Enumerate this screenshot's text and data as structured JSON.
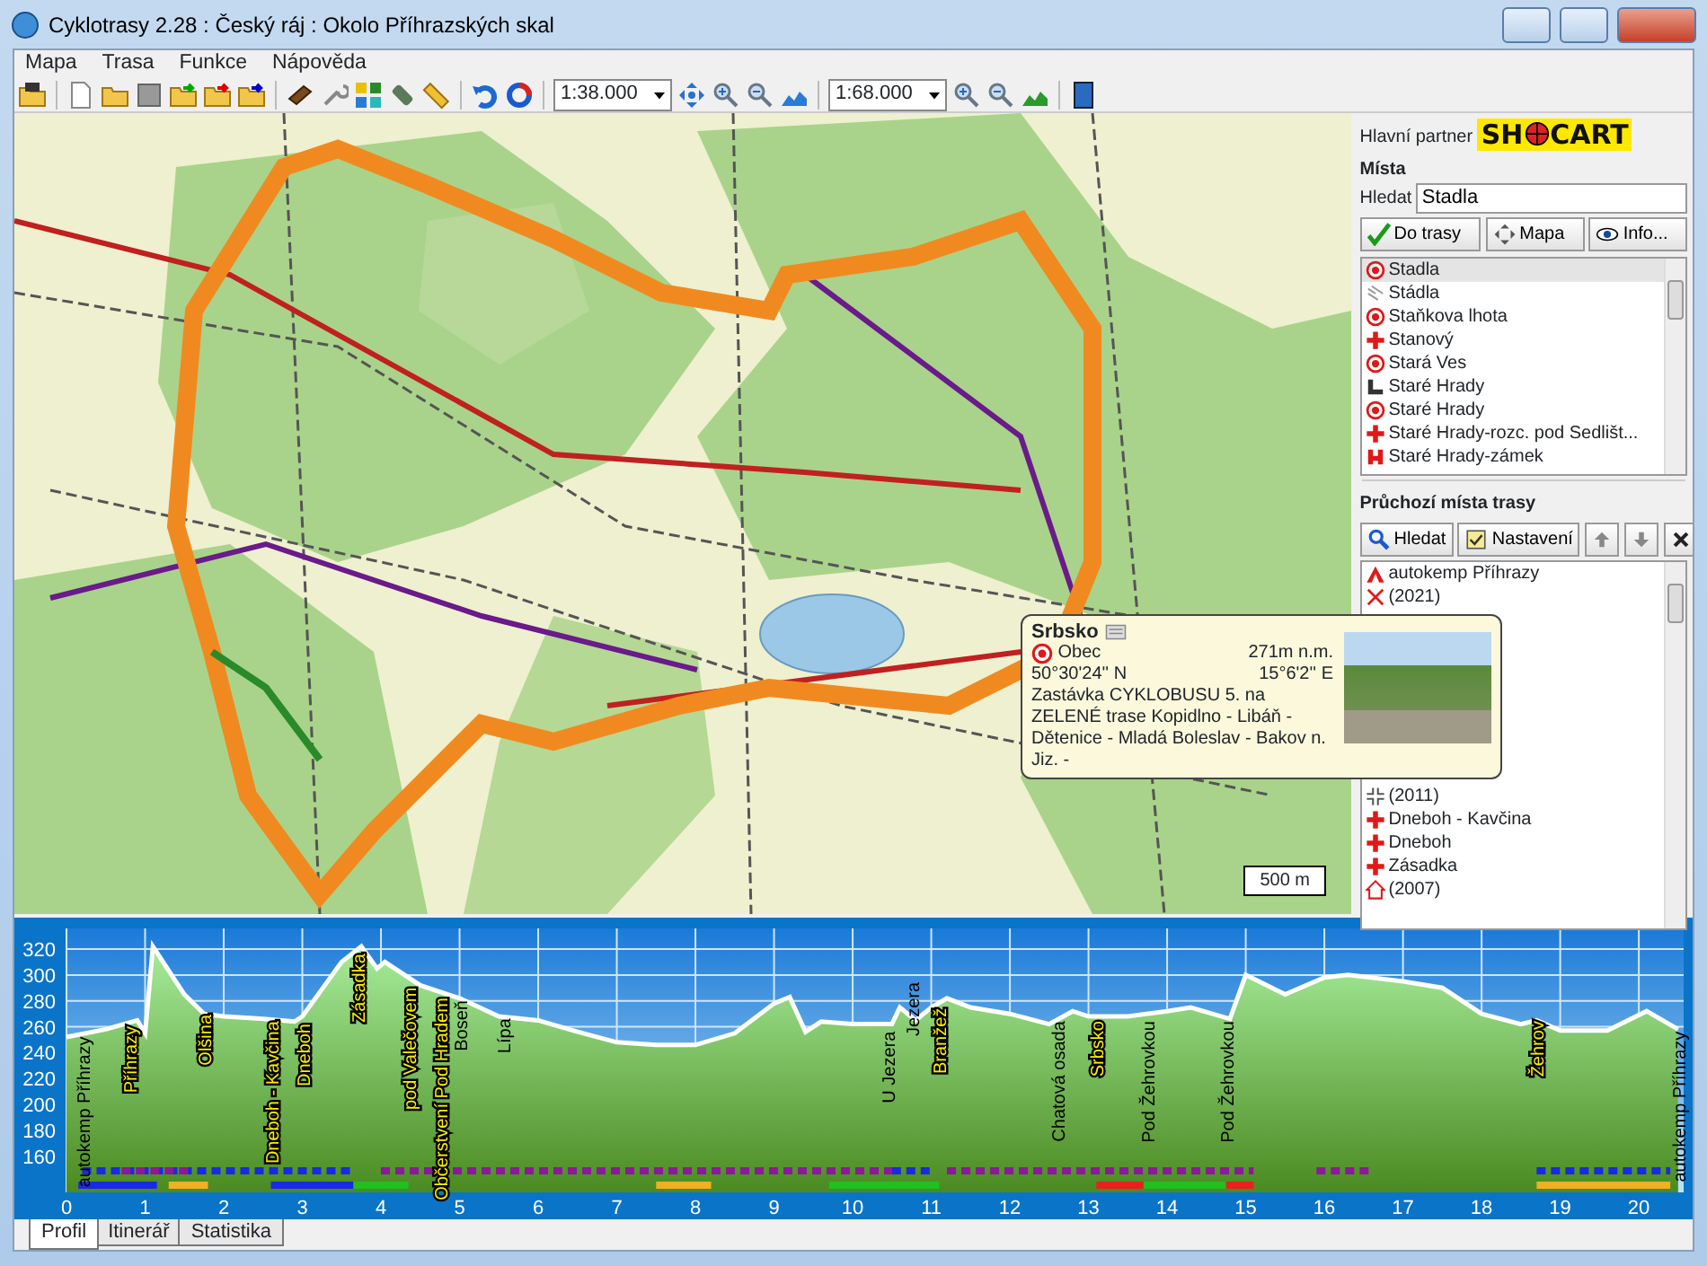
{
  "window": {
    "title": "Cyklotrasy 2.28 : Český ráj : Okolo Příhrazských skal"
  },
  "menu": [
    "Mapa",
    "Trasa",
    "Funkce",
    "Nápověda"
  ],
  "toolbar": {
    "scale_1": "1:38.000",
    "scale_2": "1:68.000"
  },
  "map": {
    "scale_label": "500 m"
  },
  "popup": {
    "title": "Srbsko",
    "type": "Obec",
    "altitude": "271m n.m.",
    "latitude": "50°30'24'' N",
    "longitude": "15°6'2'' E",
    "description": "Zastávka CYKLOBUSU 5. na ZELENÉ trase Kopidlno - Libáň - Dětenice - Mladá Boleslav - Bakov n. Jiz. -"
  },
  "sidebar": {
    "partner_label": "Hlavní partner",
    "logo_left": "SH",
    "logo_right": "CART",
    "places_title": "Místa",
    "search_label": "Hledat",
    "search_value": "Stadla",
    "buttons": [
      "Do trasy",
      "Mapa",
      "Info..."
    ],
    "places": [
      {
        "kind": "village",
        "name": "Stadla",
        "selected": true
      },
      {
        "kind": "settlement",
        "name": "Stádla",
        "selected": false
      },
      {
        "kind": "village",
        "name": "Staňkova lhota",
        "selected": false
      },
      {
        "kind": "cross",
        "name": "Stanový",
        "selected": false
      },
      {
        "kind": "village",
        "name": "Stará Ves",
        "selected": false
      },
      {
        "kind": "ruin",
        "name": "Staré Hrady",
        "selected": false
      },
      {
        "kind": "village",
        "name": "Staré Hrady",
        "selected": false
      },
      {
        "kind": "cross",
        "name": "Staré Hrady-rozc. pod Sedlišt...",
        "selected": false
      },
      {
        "kind": "castle",
        "name": "Staré Hrady-zámek",
        "selected": false
      }
    ],
    "route_title": "Průchozí místa trasy",
    "route_buttons": [
      "Hledat",
      "Nastavení"
    ],
    "route_places": [
      {
        "kind": "camp",
        "name": "autokemp Příhrazy"
      },
      {
        "kind": "service",
        "name": "(2021)"
      },
      {
        "kind": "junction",
        "name": "(2011)"
      },
      {
        "kind": "cross",
        "name": "Dneboh - Kavčina"
      },
      {
        "kind": "cross",
        "name": "Dneboh"
      },
      {
        "kind": "cross",
        "name": "Zásadka"
      },
      {
        "kind": "house",
        "name": "(2007)"
      }
    ]
  },
  "profile": {
    "chart_data": {
      "type": "area",
      "grid": true,
      "x": [
        0,
        0.5,
        0.9,
        1.0,
        1.1,
        1.5,
        1.75,
        2,
        2.5,
        2.9,
        3,
        3.5,
        3.75,
        3.95,
        4.05,
        4.5,
        5,
        5.5,
        6,
        6.5,
        7,
        7.5,
        8,
        8.5,
        9,
        9.2,
        9.4,
        9.6,
        10,
        10.5,
        10.6,
        10.8,
        11,
        11.2,
        11.5,
        12,
        12.5,
        12.8,
        13,
        13.5,
        14,
        14.3,
        14.8,
        15,
        15.5,
        16,
        16.3,
        17,
        17.5,
        18,
        18.5,
        18.7,
        19,
        19.6,
        20.1,
        20.5
      ],
      "series": [
        {
          "color": "#ffffff",
          "values": [
            252,
            258,
            265,
            255,
            322,
            285,
            270,
            268,
            266,
            264,
            268,
            310,
            322,
            305,
            310,
            292,
            282,
            268,
            265,
            256,
            248,
            246,
            246,
            255,
            278,
            283,
            256,
            264,
            262,
            262,
            275,
            265,
            275,
            282,
            275,
            270,
            262,
            272,
            268,
            268,
            272,
            275,
            266,
            300,
            285,
            298,
            300,
            295,
            290,
            270,
            262,
            265,
            257,
            257,
            272,
            258
          ]
        }
      ],
      "xlim": [
        0,
        20.57
      ],
      "ylim": [
        132,
        336
      ],
      "xticks": [
        0,
        1,
        2,
        3,
        4,
        5,
        6,
        7,
        8,
        9,
        10,
        11,
        12,
        13,
        14,
        15,
        16,
        17,
        18,
        19,
        20
      ],
      "yticks": [
        160,
        180,
        200,
        220,
        240,
        260,
        280,
        300,
        320
      ]
    },
    "place_labels": [
      {
        "text": "autokemp Příhrazy",
        "highlighted": false
      },
      {
        "text": "Příhrazy",
        "highlighted": true
      },
      {
        "text": "Olšina",
        "highlighted": true
      },
      {
        "text": "Dneboh - Kavčina",
        "highlighted": true
      },
      {
        "text": "Dneboh",
        "highlighted": true
      },
      {
        "text": "Zásadka",
        "highlighted": true
      },
      {
        "text": "pod Valečovem",
        "highlighted": true
      },
      {
        "text": "Občerstvení Pod Hradem",
        "highlighted": true
      },
      {
        "text": "Boseň",
        "highlighted": false
      },
      {
        "text": "Lípa",
        "highlighted": false
      },
      {
        "text": "U Jezera",
        "highlighted": false
      },
      {
        "text": "Jezera",
        "highlighted": false
      },
      {
        "text": "Branžež",
        "highlighted": true
      },
      {
        "text": "Chatová osada",
        "highlighted": false
      },
      {
        "text": "Srbsko",
        "highlighted": true
      },
      {
        "text": "Pod Žehrovkou",
        "highlighted": false
      },
      {
        "text": "Pod Žehrovkou",
        "highlighted": false
      },
      {
        "text": "Žehrov",
        "highlighted": true
      },
      {
        "text": "autokemp Příhrazy",
        "highlighted": false
      }
    ]
  },
  "tabs": [
    {
      "label": "Profil",
      "selected": true
    },
    {
      "label": "Itinerář",
      "selected": false
    },
    {
      "label": "Statistika",
      "selected": false
    }
  ]
}
